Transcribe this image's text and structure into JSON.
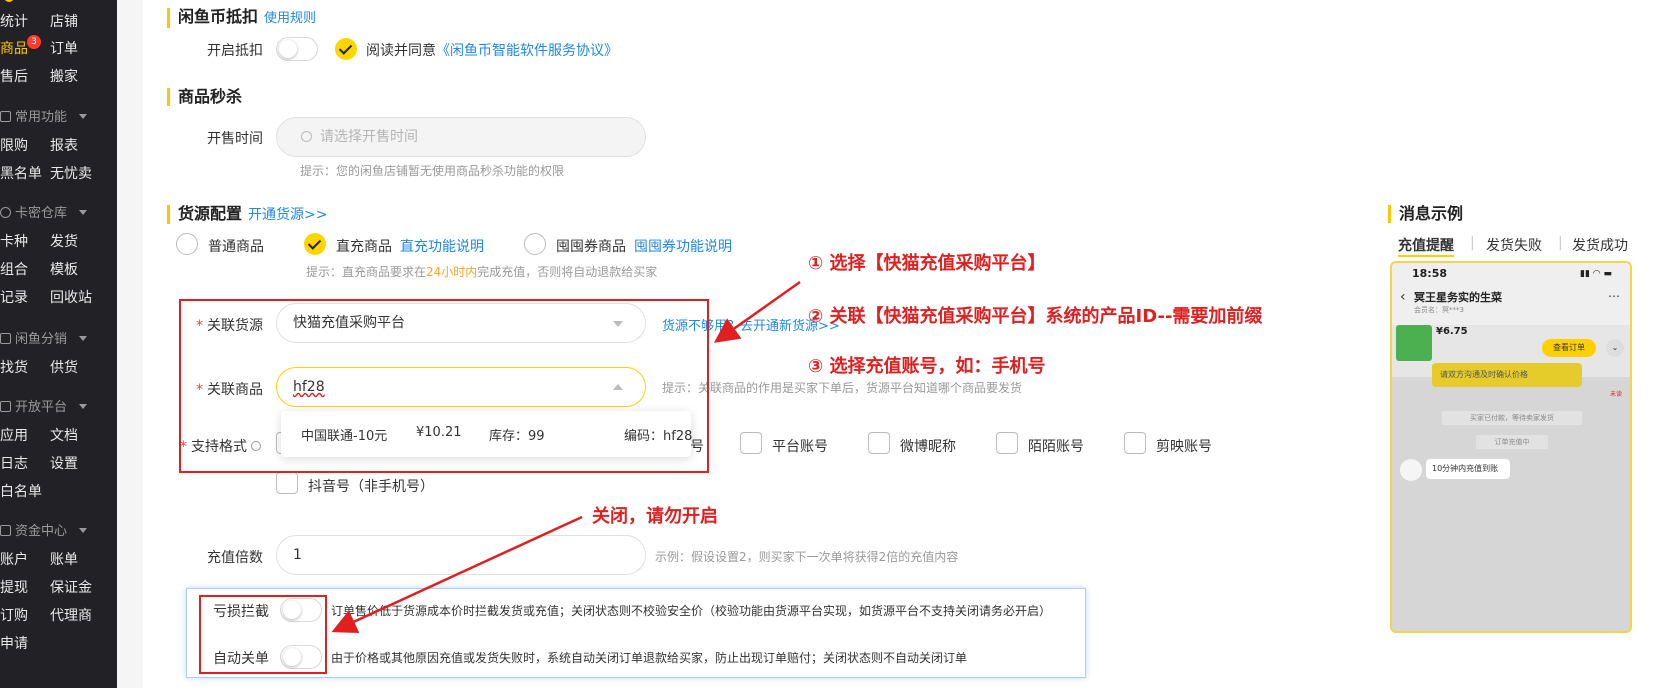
{
  "sidebar": {
    "rows": [
      [
        "统计",
        "店铺"
      ],
      [
        "商品",
        "订单"
      ],
      [
        "售后",
        "搬家"
      ],
      [
        "限购",
        "报表"
      ],
      [
        "黑名单",
        "无忧卖"
      ],
      [
        "卡种",
        "发货"
      ],
      [
        "组合",
        "模板"
      ],
      [
        "记录",
        "回收站"
      ],
      [
        "找货",
        "供货"
      ],
      [
        "应用",
        "文档"
      ],
      [
        "日志",
        "设置"
      ],
      [
        "白名单",
        ""
      ],
      [
        "账户",
        "账单"
      ],
      [
        "提现",
        "保证金"
      ],
      [
        "订购",
        "代理商"
      ],
      [
        "申请",
        ""
      ]
    ],
    "badge": "3",
    "groups": [
      "常用功能",
      "卡密仓库",
      "闲鱼分销",
      "开放平台",
      "资金中心"
    ]
  },
  "coin": {
    "title": "闲鱼币抵扣",
    "rules_link": "使用规则",
    "enable_label": "开启抵扣",
    "agree_text": "阅读并同意",
    "agreement_link": "《闲鱼币智能软件服务协议》"
  },
  "flash": {
    "title": "商品秒杀",
    "time_label": "开售时间",
    "time_placeholder": "请选择开售时间",
    "hint": "提示：您的闲鱼店铺暂无使用商品秒杀功能的权限"
  },
  "supply": {
    "title": "货源配置",
    "open_link": "开通货源>>",
    "options": [
      {
        "label": "普通商品",
        "link": ""
      },
      {
        "label": "直充商品",
        "link": "直充功能说明"
      },
      {
        "label": "囤囤券商品",
        "link": "囤囤券功能说明"
      }
    ],
    "hint_prefix": "提示：直充商品要求在",
    "hint_highlight": "24小时内",
    "hint_suffix": "完成充值，否则将自动退款给买家",
    "source_label": "关联货源",
    "source_value": "快猫充值采购平台",
    "source_link": "货源不够用？去开通新货源>>",
    "product_label": "关联商品",
    "product_value": "hf28",
    "product_hint": "提示：关联商品的作用是买家下单后，货源平台知道哪个商品要发货",
    "dropdown": {
      "name": "中国联通-10元",
      "price": "¥10.21",
      "stock": "库存：99",
      "code": "编码：hf28"
    },
    "format_label": "支持格式",
    "formats": [
      "平台账号",
      "微博昵称",
      "陌陌账号",
      "剪映账号"
    ],
    "format_hidden_suffix": "号",
    "format_row2": "抖音号（非手机号）",
    "multiple_label": "充值倍数",
    "multiple_value": "1",
    "multiple_hint": "示例：假设设置2，则买家下一次单将获得2倍的充值内容",
    "loss_label": "亏损拦截",
    "loss_desc": "订单售价低于货源成本价时拦截发货或充值；关闭状态则不校验安全价（校验功能由货源平台实现，如货源平台不支持关闭请务必开启）",
    "autoclose_label": "自动关单",
    "autoclose_desc": "由于价格或其他原因充值或发货失败时，系统自动关闭订单退款给买家，防止出现订单赔付；关闭状态则不自动关闭订单"
  },
  "annotations": {
    "step1": "① 选择【快猫充值采购平台】",
    "step2": "② 关联【快猫充值采购平台】系统的产品ID--需要加前缀",
    "step3": "③ 选择充值账号，如：手机号",
    "close_note": "关闭，请勿开启"
  },
  "message": {
    "title": "消息示例",
    "tabs": [
      "充值提醒",
      "发货失败",
      "发货成功"
    ],
    "phone": {
      "time": "18:58",
      "shop": "冥王星务实的生菜",
      "shop_sub": "会员名：冥***3",
      "price": "¥6.75",
      "order_btn": "查看订单",
      "bubble1": "请双方沟通及时确认价格",
      "tag": "未读",
      "sys1": "买家已付款，等待卖家发货",
      "sys2": "订单充值中",
      "bubble2": "10分钟内充值到账"
    }
  },
  "colors": {
    "accent": "#ffc700",
    "annotation": "#e02020",
    "link": "#1e88e5"
  }
}
